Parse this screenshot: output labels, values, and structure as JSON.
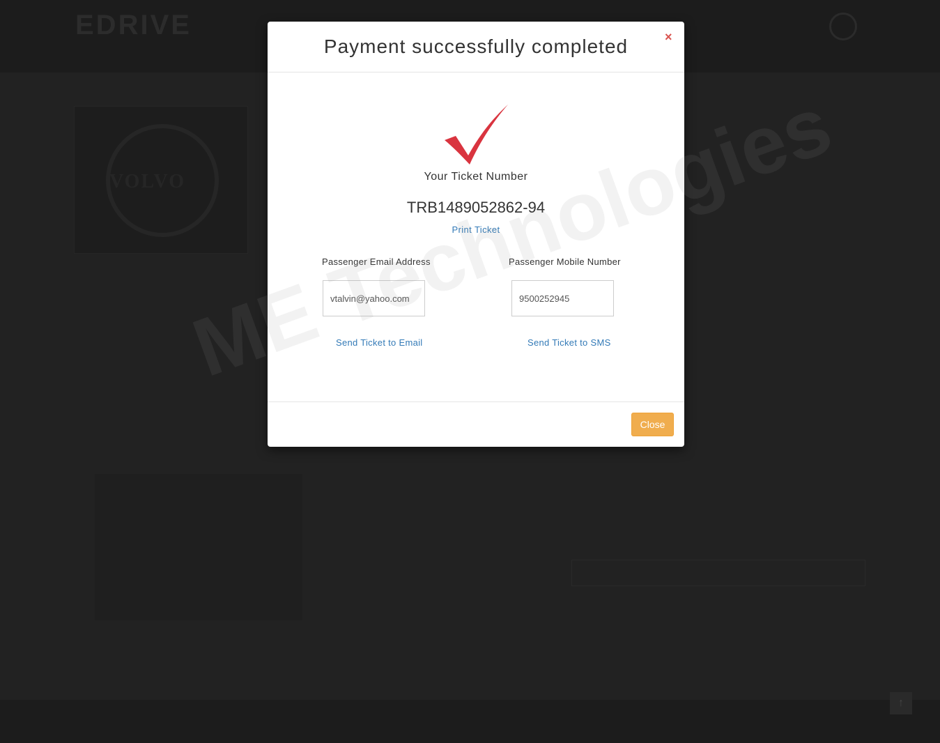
{
  "modal": {
    "title": "Payment successfully completed",
    "close_x": "×",
    "ticket_label": "Your Ticket Number",
    "ticket_number": "TRB1489052862-94",
    "print_link": "Print Ticket",
    "email": {
      "label": "Passenger Email Address",
      "value": "vtalvin@yahoo.com",
      "send_link": "Send Ticket to Email"
    },
    "mobile": {
      "label": "Passenger Mobile Number",
      "value": "9500252945",
      "send_link": "Send Ticket to SMS"
    },
    "close_button": "Close"
  },
  "watermark": "ME Technologies",
  "background": {
    "logo": "EDRIVE",
    "card_brand": "VOLVO",
    "scroll_top": "↑"
  },
  "colors": {
    "check": "#d9343f",
    "close_x": "#d9534f",
    "link": "#337ab7",
    "close_button": "#f0ad4e",
    "overlay": "#222222"
  }
}
